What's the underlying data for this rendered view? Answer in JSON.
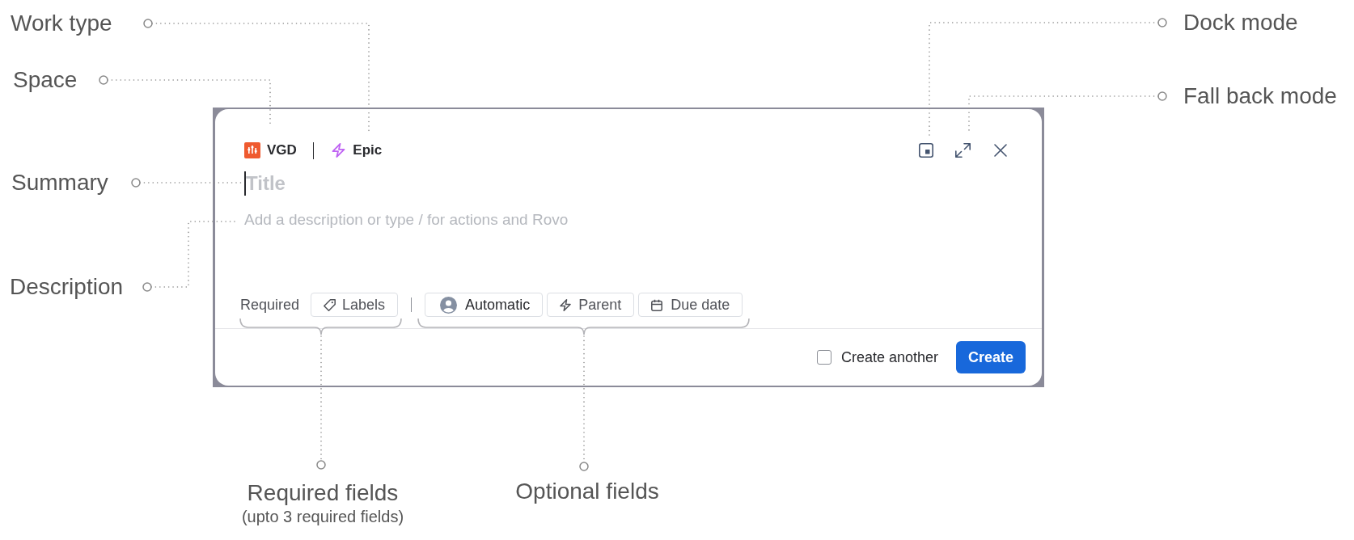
{
  "dialog": {
    "space": {
      "label": "VGD"
    },
    "work_type": {
      "label": "Epic"
    },
    "summary": {
      "placeholder": "Title",
      "focused": true
    },
    "description": {
      "placeholder": "Add a description or type / for actions and Rovo"
    },
    "required": {
      "label": "Required",
      "fields": [
        {
          "kind": "labels",
          "label": "Labels",
          "filled": false
        }
      ]
    },
    "optional_fields": [
      {
        "kind": "assignee",
        "label": "Automatic",
        "filled": true
      },
      {
        "kind": "parent",
        "label": "Parent",
        "filled": false
      },
      {
        "kind": "date",
        "label": "Due date",
        "filled": false
      }
    ],
    "create_another": {
      "label": "Create another",
      "checked": false
    },
    "create_button": {
      "label": "Create"
    }
  },
  "annotations": [
    {
      "kind": "work_type",
      "label": "Work type"
    },
    {
      "kind": "space",
      "label": "Space"
    },
    {
      "kind": "summary",
      "label": "Summary"
    },
    {
      "kind": "description",
      "label": "Description"
    },
    {
      "kind": "dock",
      "label": "Dock mode"
    },
    {
      "kind": "fallback",
      "label": "Fall back mode"
    },
    {
      "kind": "required",
      "label": "Required fields",
      "note": "(upto 3 required fields)"
    },
    {
      "kind": "optional",
      "label": "Optional fields"
    }
  ]
}
